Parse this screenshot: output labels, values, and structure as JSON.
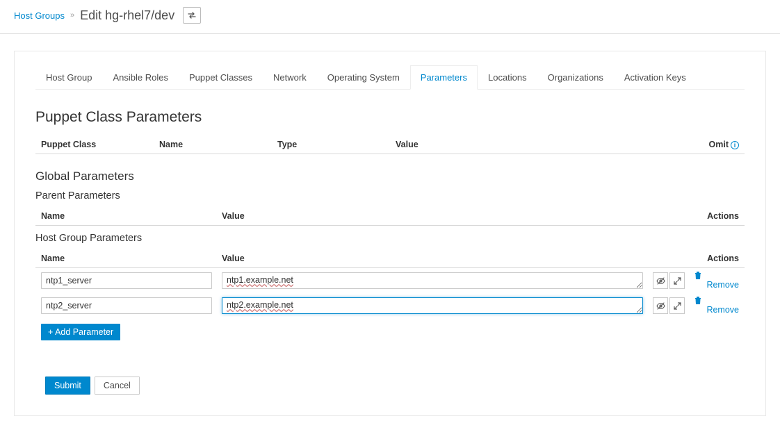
{
  "breadcrumb": {
    "root": "Host Groups",
    "sep": "»",
    "title": "Edit hg-rhel7/dev"
  },
  "tabs": [
    {
      "label": "Host Group",
      "active": false
    },
    {
      "label": "Ansible Roles",
      "active": false
    },
    {
      "label": "Puppet Classes",
      "active": false
    },
    {
      "label": "Network",
      "active": false
    },
    {
      "label": "Operating System",
      "active": false
    },
    {
      "label": "Parameters",
      "active": true
    },
    {
      "label": "Locations",
      "active": false
    },
    {
      "label": "Organizations",
      "active": false
    },
    {
      "label": "Activation Keys",
      "active": false
    }
  ],
  "puppet": {
    "heading": "Puppet Class Parameters",
    "cols": {
      "c1": "Puppet Class",
      "c2": "Name",
      "c3": "Type",
      "c4": "Value",
      "c5": "Omit"
    }
  },
  "global": {
    "heading": "Global Parameters",
    "parent_heading": "Parent Parameters",
    "parent_cols": {
      "name": "Name",
      "value": "Value",
      "actions": "Actions"
    },
    "hg_heading": "Host Group Parameters",
    "hg_cols": {
      "name": "Name",
      "value": "Value",
      "actions": "Actions"
    },
    "rows": [
      {
        "name": "ntp1_server",
        "value": "ntp1.example.net",
        "focused": false
      },
      {
        "name": "ntp2_server",
        "value": "ntp2.example.net",
        "focused": true
      }
    ],
    "add_label": "+ Add Parameter",
    "remove_label": "Remove"
  },
  "actions": {
    "submit": "Submit",
    "cancel": "Cancel"
  },
  "icons": {
    "hide": "eye-slash",
    "expand": "expand",
    "trash": "trash",
    "swap": "swap"
  }
}
